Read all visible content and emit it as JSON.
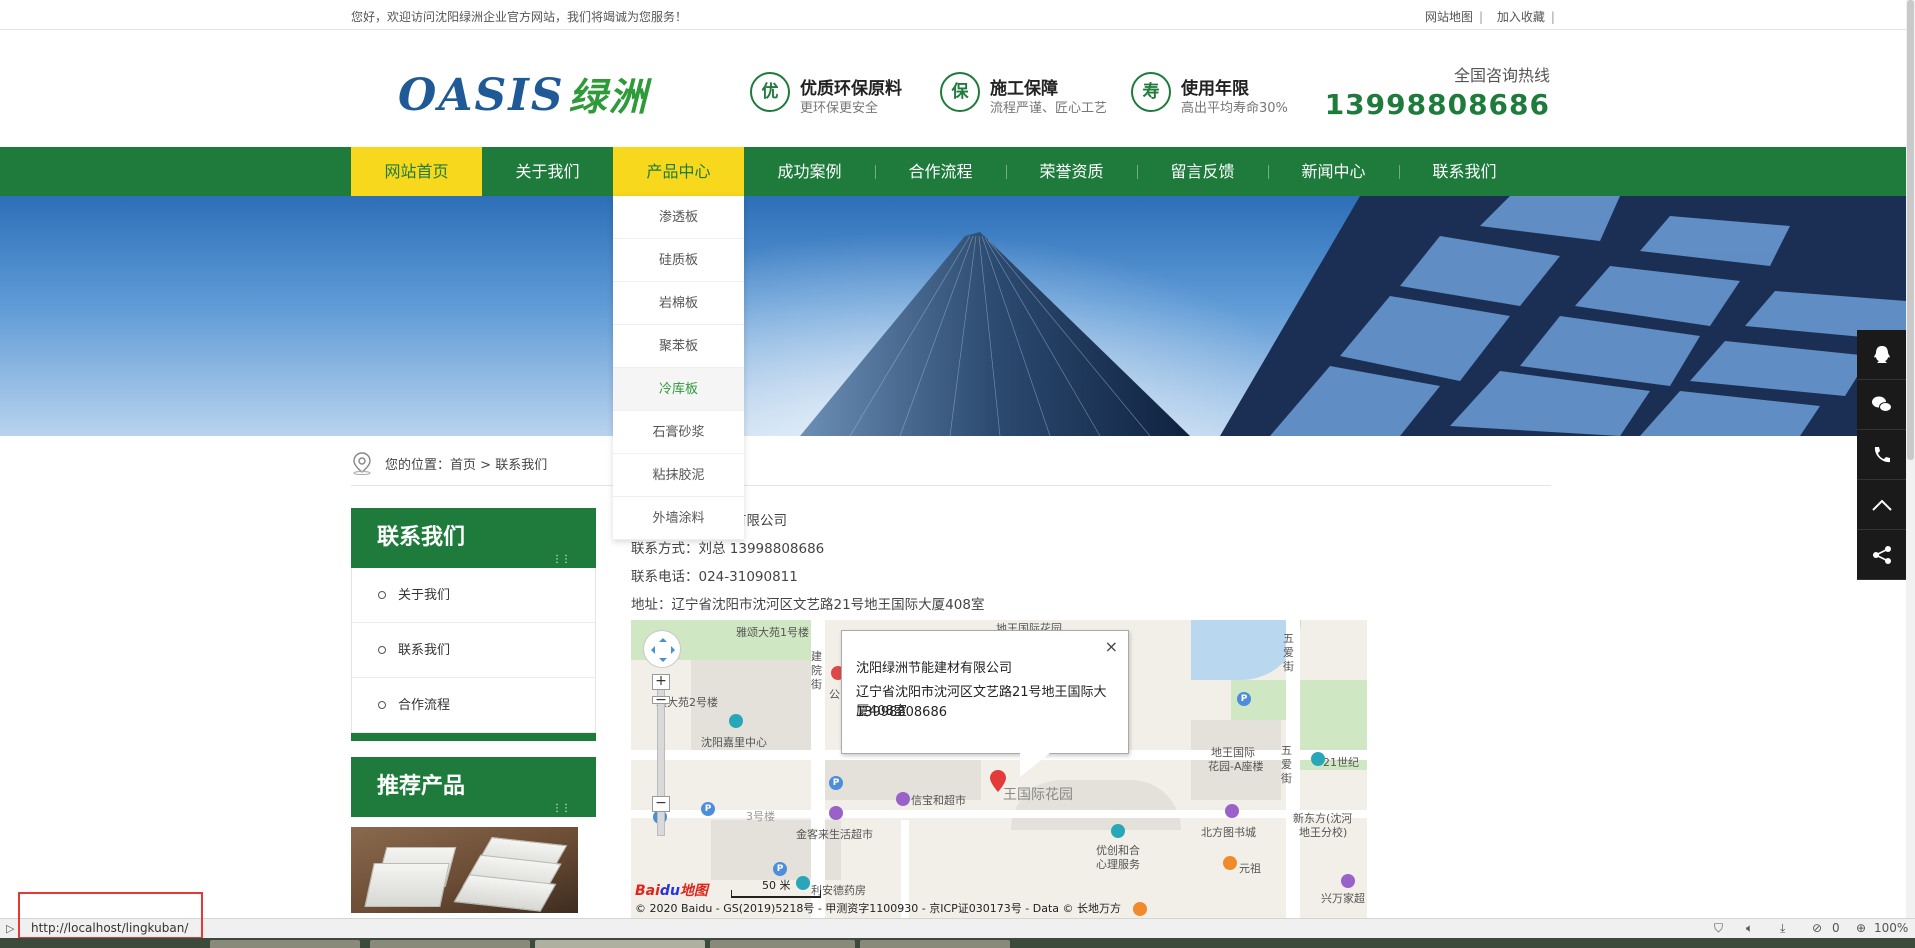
{
  "topbar": {
    "welcome": "您好，欢迎访问沈阳绿洲企业官方网站，我们将竭诚为您服务！",
    "sitemap": "网站地图",
    "favorite": "加入收藏"
  },
  "header": {
    "logo_en": "OASIS",
    "logo_cn": "绿洲",
    "features": [
      {
        "badge": "优",
        "title": "优质环保原料",
        "sub": "更环保更安全"
      },
      {
        "badge": "保",
        "title": "施工保障",
        "sub": "流程严谨、匠心工艺"
      },
      {
        "badge": "寿",
        "title": "使用年限",
        "sub": "高出平均寿命30%"
      }
    ],
    "hotline_label": "全国咨询热线",
    "hotline_number": "13998808686"
  },
  "nav": {
    "items": [
      "网站首页",
      "关于我们",
      "产品中心",
      "成功案例",
      "合作流程",
      "荣誉资质",
      "留言反馈",
      "新闻中心",
      "联系我们"
    ],
    "active_index": 0,
    "open_index": 2
  },
  "dropdown": {
    "items": [
      "渗透板",
      "硅质板",
      "岩棉板",
      "聚苯板",
      "冷库板",
      "石膏砂浆",
      "粘抹胶泥",
      "外墙涂料"
    ],
    "hover_index": 4
  },
  "breadcrumb": {
    "prefix": "您的位置：",
    "home": "首页",
    "sep": " > ",
    "current": "联系我们"
  },
  "sidebar": {
    "contact_title": "联系我们",
    "more_glyph": "⋮⋮",
    "items": [
      "关于我们",
      "联系我们",
      "合作流程"
    ],
    "products_title": "推荐产品"
  },
  "contact": {
    "company_visible": "有限公司",
    "contact_person": "联系方式：刘总 13998808686",
    "phone": "联系电话：024-31090811",
    "address": "地址：辽宁省沈阳市沈河区文艺路21号地王国际大厦408室"
  },
  "map": {
    "info_company": "沈阳绿洲节能建材有限公司",
    "info_address": "辽宁省沈阳市沈河区文艺路21号地王国际大厦408室",
    "info_phone": "13998808686",
    "close": "×",
    "labels": {
      "l1": "雅颂大苑1号楼",
      "l2": "地王国际花园",
      "l3": "建",
      "l4": "院",
      "l5": "街",
      "l6": "公",
      "l7": "颂大苑2号楼",
      "l8": "沈阳嘉里中心",
      "l9": "五",
      "l10": "爱",
      "l11": "街",
      "l12": "地王国际",
      "l13": "花园-A座楼",
      "l14": "21世纪",
      "l15": "信宝和超市",
      "l16": "王国际花园",
      "l17": "3号楼",
      "l18": "金客来生活超市",
      "l19": "北方图书城",
      "l20": "新东方(沈河",
      "l21": "地王分校)",
      "l22": "优创和合",
      "l23": "心理服务",
      "l24": "元祖",
      "l25": "利安德药房",
      "l26": "兴万家超",
      "l27": "五",
      "l28": "爱",
      "l29": "街"
    },
    "scale": "50 米",
    "copyright": "© 2020 Baidu - GS(2019)5218号 - 甲测资字1100930 - 京ICP证030173号 - Data © 长地万方",
    "baidu_logo_a": "Bai",
    "baidu_logo_b": "du",
    "baidu_logo_c": "地图"
  },
  "statusbar": {
    "url": "http://localhost/lingkuban/",
    "count": "0",
    "zoom": "100%"
  }
}
